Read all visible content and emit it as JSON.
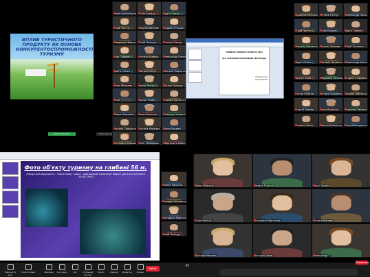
{
  "q1_slide": {
    "title": "ВПЛИВ ТУРИСТИЧНОГО ПРОДУКТУ ЯК ОСНОВА КОНКУРЕНТОСПРОМОЖНОСТІ ТУРИЗМУ",
    "bottom_bar_btn": "Натиснути тут",
    "bottom_bar_btn2": "Натисніть сюди"
  },
  "q1_grid": [
    {
      "name": "Pavlo Lytovchenko"
    },
    {
      "name": "Юлія Бондар"
    },
    {
      "name": "Дарʼя Савчук"
    },
    {
      "name": "Юрій Пастух"
    },
    {
      "name": "Lilia Bondarenko"
    },
    {
      "name": "Андрій Огурцов"
    },
    {
      "name": "Людмила Шевчук"
    },
    {
      "name": "Юрій Поліщук"
    },
    {
      "name": "Оксана Савчук"
    },
    {
      "name": "Ігор Гайовий"
    },
    {
      "name": "Тетяна Кравець"
    },
    {
      "name": "Олександр Ключник"
    },
    {
      "name": "Дарʼя Семко"
    },
    {
      "name": "Наталія Когут"
    },
    {
      "name": "Наталія Радченко"
    },
    {
      "name": "Олег Мельник"
    },
    {
      "name": "Ірина Ткачук"
    },
    {
      "name": "Віктор Поліщук"
    },
    {
      "name": "Клон"
    },
    {
      "name": "Ірина Гілова"
    },
    {
      "name": "Оксана Лук'янчук"
    },
    {
      "name": "Olena Kosarenko"
    },
    {
      "name": "Lesia Baranova"
    },
    {
      "name": "Liubomyr Vachenko"
    },
    {
      "name": "Оксана Саврасова"
    },
    {
      "name": "Оксана Ковалюк"
    },
    {
      "name": "Ірина Бакман"
    },
    {
      "name": "Катерина Павлюк"
    },
    {
      "name": "Олег Майданюк"
    },
    {
      "name": "Маргарита Шевчук"
    }
  ],
  "q2_doc": {
    "line1": "РОЗВИТОК ТУРИЗМУ В УКРАЇНІ ТА СВІТІ",
    "line2": "Ю.А. ЗАЛІЗНИЧНА ПАРАЛЕЛЬНИЙ СЕКТОР Юрій",
    "line3": "Аспірант Ivano",
    "line4": "Ivano-Frankivsk"
  },
  "q2_grid": [
    {
      "name": "Lyudmila Mertsalova"
    },
    {
      "name": "Тетяна Ганчук"
    },
    {
      "name": "Олександр Поліщук"
    },
    {
      "name": "Юрій Пастух"
    },
    {
      "name": "Юлія Бондар"
    },
    {
      "name": "Дарʼя Савчук"
    },
    {
      "name": "Наталія Юрченко"
    },
    {
      "name": "Оксана Козлова"
    },
    {
      "name": "Юрій Ткаченко"
    },
    {
      "name": "Дарʼя Семко"
    },
    {
      "name": "Наталія Литвиненко"
    },
    {
      "name": "Олександр Ключник"
    },
    {
      "name": "Ірина Гілова"
    },
    {
      "name": "Людмила Козлова"
    },
    {
      "name": "Андрій Оліфіренко"
    },
    {
      "name": "Ганна Олійник"
    },
    {
      "name": "Тетяна Гриценко"
    },
    {
      "name": "Оксана Лук'янчук"
    },
    {
      "name": "Сергій Павлюк"
    },
    {
      "name": "Lesia Baranova"
    },
    {
      "name": "Liubomyr Vachenko"
    },
    {
      "name": "Оксана Сахно"
    },
    {
      "name": "Іванна Ковальчук"
    },
    {
      "name": "Сергій Бондаренко"
    }
  ],
  "q3_slide": {
    "title": "Фото об'єкту туризму на глибині 56 м.",
    "subtitle": "(Місце розташування - Чорне море, човен - військовий транспорт Варна, дата потоплення - 30.08.1943 )"
  },
  "q3_side": [
    {
      "name": "Олена Мельник"
    },
    {
      "name": "Валерія Світлична"
    },
    {
      "name": "Катерина Мартинюк"
    },
    {
      "name": "Юрій Поліщук"
    }
  ],
  "q4_grid": [
    {
      "name": "Olena Poliarush"
    },
    {
      "name": "Natalia Tkachuk"
    },
    {
      "name": "Vasyl Sorokin"
    },
    {
      "name": "Юрій Pavlyuk"
    },
    {
      "name": "Катерина Мартинюк"
    },
    {
      "name": "Тетяна Іванова"
    },
    {
      "name": "Вікторія Маслюк"
    },
    {
      "name": "Вікторія Дяків"
    },
    {
      "name": "Олександр Т"
    }
  ],
  "toolbar": {
    "left": [
      "Увімкнути звук",
      "Почати відео"
    ],
    "center": [
      "Безпека",
      "Учасники",
      "Чат",
      "Спільний доступ",
      "Запис",
      "Реакції",
      "Додатки",
      "Дошки"
    ],
    "end": "Вийти",
    "end2": "Завершити",
    "counter": "97"
  },
  "colors": {
    "accent_green": "#2ea44f",
    "end_red": "#d22233",
    "slide_blue": "#5a3fb0"
  }
}
